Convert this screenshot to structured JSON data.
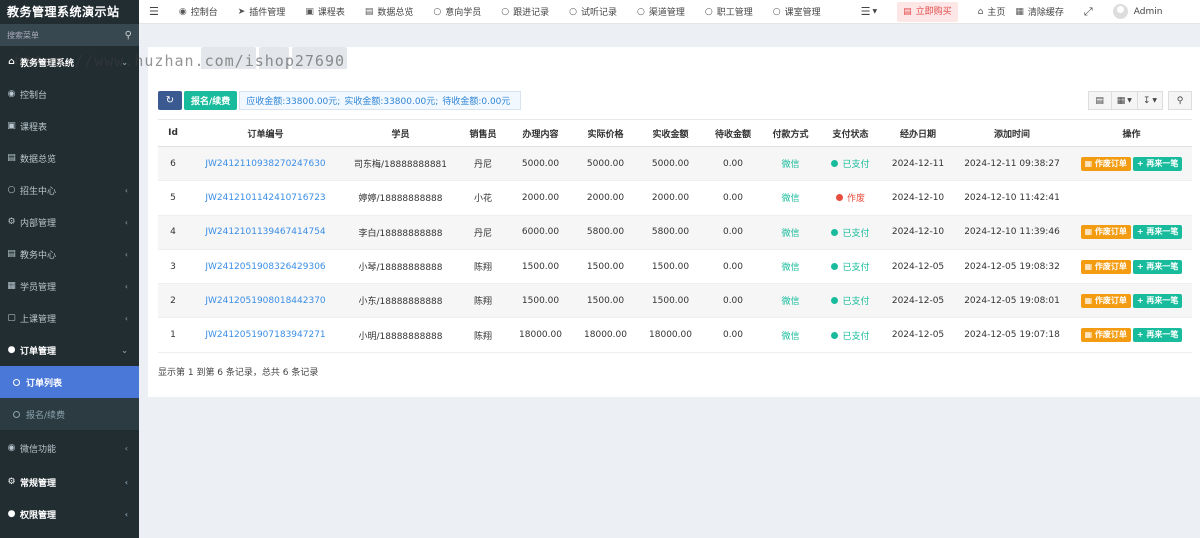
{
  "brand": "教务管理系统演示站",
  "sidebar": {
    "search_placeholder": "搜索菜单",
    "items": [
      {
        "label": "教务管理系统",
        "type": "header"
      },
      {
        "label": "控制台"
      },
      {
        "label": "课程表"
      },
      {
        "label": "数据总览"
      },
      {
        "label": "招生中心"
      },
      {
        "label": "内部管理"
      },
      {
        "label": "教务中心"
      },
      {
        "label": "学员管理"
      },
      {
        "label": "上课管理"
      },
      {
        "label": "订单管理"
      },
      {
        "label": "订单列表"
      },
      {
        "label": "报名/续费"
      },
      {
        "label": "微信功能"
      },
      {
        "label": "常规管理"
      },
      {
        "label": "权限管理"
      }
    ]
  },
  "topnav": {
    "items": [
      "控制台",
      "插件管理",
      "课程表",
      "数据总览",
      "意向学员",
      "跟进记录",
      "试听记录",
      "渠道管理",
      "职工管理",
      "课室管理"
    ],
    "buy": "立即购买",
    "home": "主页",
    "clear_cache": "清除缓存",
    "user": "Admin"
  },
  "watermark": "https://www.huzhan.com/ishop27690",
  "toolbar": {
    "signup_label": "报名/续费",
    "receivable": "应收金额:33800.00元;",
    "received": "实收金额:33800.00元;",
    "pending": "待收金额:0.00元"
  },
  "table": {
    "headers": [
      "Id",
      "订单编号",
      "学员",
      "销售员",
      "办理内容",
      "实际价格",
      "实收金额",
      "待收金额",
      "付款方式",
      "支付状态",
      "经办日期",
      "添加时间",
      "操作"
    ],
    "rows": [
      {
        "id": "6",
        "order": "JW2412110938270247630",
        "student": "司东梅/18888888881",
        "seller": "丹尼",
        "content": "5000.00",
        "price": "5000.00",
        "paid": "5000.00",
        "due": "0.00",
        "method": "微信",
        "status": "已支付",
        "status_type": "paid",
        "date": "2024-12-11",
        "time": "2024-12-11 09:38:27",
        "actions": true
      },
      {
        "id": "5",
        "order": "JW2412101142410716723",
        "student": "婷婷/18888888888",
        "seller": "小花",
        "content": "2000.00",
        "price": "2000.00",
        "paid": "2000.00",
        "due": "0.00",
        "method": "微信",
        "status": "作废",
        "status_type": "void",
        "date": "2024-12-10",
        "time": "2024-12-10 11:42:41",
        "actions": false
      },
      {
        "id": "4",
        "order": "JW2412101139467414754",
        "student": "李白/18888888888",
        "seller": "丹尼",
        "content": "6000.00",
        "price": "5800.00",
        "paid": "5800.00",
        "due": "0.00",
        "method": "微信",
        "status": "已支付",
        "status_type": "paid",
        "date": "2024-12-10",
        "time": "2024-12-10 11:39:46",
        "actions": true
      },
      {
        "id": "3",
        "order": "JW2412051908326429306",
        "student": "小琴/18888888888",
        "seller": "陈翔",
        "content": "1500.00",
        "price": "1500.00",
        "paid": "1500.00",
        "due": "0.00",
        "method": "微信",
        "status": "已支付",
        "status_type": "paid",
        "date": "2024-12-05",
        "time": "2024-12-05 19:08:32",
        "actions": true
      },
      {
        "id": "2",
        "order": "JW2412051908018442370",
        "student": "小东/18888888888",
        "seller": "陈翔",
        "content": "1500.00",
        "price": "1500.00",
        "paid": "1500.00",
        "due": "0.00",
        "method": "微信",
        "status": "已支付",
        "status_type": "paid",
        "date": "2024-12-05",
        "time": "2024-12-05 19:08:01",
        "actions": true
      },
      {
        "id": "1",
        "order": "JW2412051907183947271",
        "student": "小明/18888888888",
        "seller": "陈翔",
        "content": "18000.00",
        "price": "18000.00",
        "paid": "18000.00",
        "due": "0.00",
        "method": "微信",
        "status": "已支付",
        "status_type": "paid",
        "date": "2024-12-05",
        "time": "2024-12-05 19:07:18",
        "actions": true
      }
    ],
    "action_cancel": "作废订单",
    "action_again": "再来一笔"
  },
  "pageinfo": "显示第 1 到第 6 条记录，总共 6 条记录"
}
